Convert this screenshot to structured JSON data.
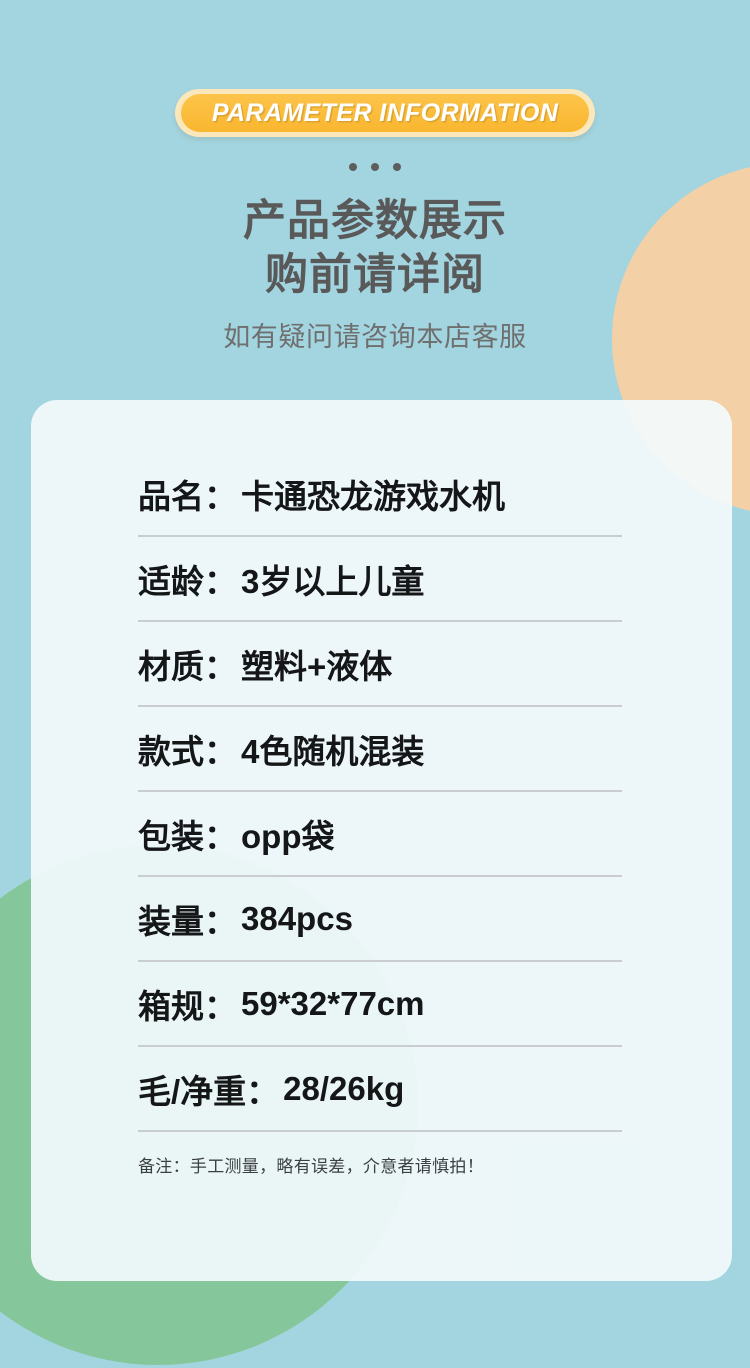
{
  "banner": {
    "label": "PARAMETER INFORMATION",
    "pill_color": "#f9b62f",
    "ring_color": "#fbe7bc",
    "text_color": "#ffffff"
  },
  "decor": {
    "dots_count": 3,
    "dot_color": "#5e5e5e",
    "background_color": "#a3d5e0",
    "orange_circle_color": "#f4d0a6",
    "green_circle_color": "#85c79b",
    "card_color": "#f2fafc"
  },
  "header": {
    "title_line1": "产品参数展示",
    "title_line2": "购前请详阅",
    "subtitle": "如有疑问请咨询本店客服"
  },
  "specs": {
    "rows": [
      {
        "label": "品名：",
        "value": "卡通恐龙游戏水机"
      },
      {
        "label": "适龄：",
        "value": "3岁以上儿童"
      },
      {
        "label": "材质：",
        "value": "塑料+液体"
      },
      {
        "label": "款式：",
        "value": "4色随机混装"
      },
      {
        "label": "包装：",
        "value": "opp袋"
      },
      {
        "label": "装量：",
        "value": "384pcs"
      },
      {
        "label": "箱规：",
        "value": "59*32*77cm"
      },
      {
        "label": "毛/净重：",
        "value": "28/26kg"
      }
    ]
  },
  "note": {
    "text": "备注：手工测量，略有误差，介意者请慎拍！"
  }
}
